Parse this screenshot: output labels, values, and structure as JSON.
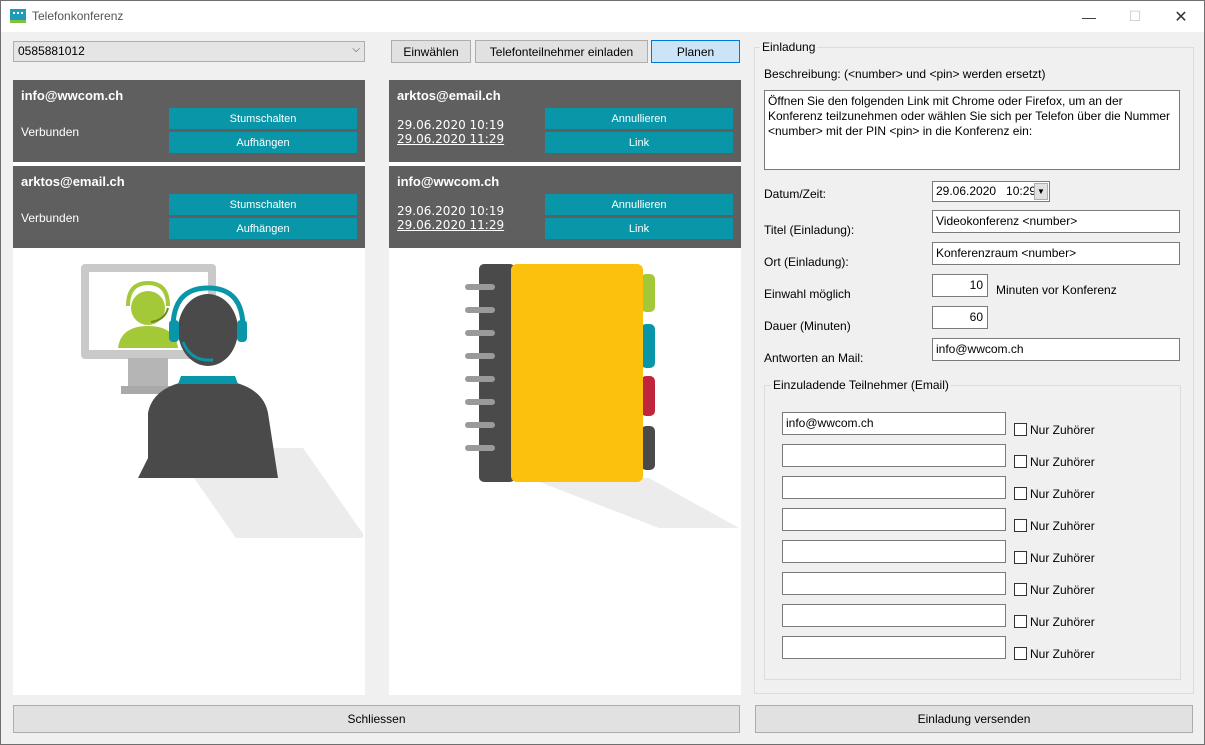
{
  "window": {
    "title": "Telefonkonferenz",
    "min": "—",
    "max": "☐",
    "close": "✕"
  },
  "phone": {
    "value": "0585881012"
  },
  "actions": {
    "dial": "Einwählen",
    "invite_phone": "Telefonteilnehmer einladen",
    "plan": "Planen"
  },
  "left_cards": [
    {
      "email": "info@wwcom.ch",
      "status": "Verbunden",
      "mute": "Stumschalten",
      "hangup": "Aufhängen"
    },
    {
      "email": "arktos@email.ch",
      "status": "Verbunden",
      "mute": "Stumschalten",
      "hangup": "Aufhängen"
    }
  ],
  "mid_cards": [
    {
      "email": "arktos@email.ch",
      "start": "29.06.2020 10:19",
      "end": "29.06.2020 11:29",
      "cancel": "Annullieren",
      "link": "Link"
    },
    {
      "email": "info@wwcom.ch",
      "start": "29.06.2020 10:19",
      "end": "29.06.2020 11:29",
      "cancel": "Annullieren",
      "link": "Link"
    }
  ],
  "invite": {
    "group_label": "Einladung",
    "desc_label": "Beschreibung: (<number> und <pin> werden ersetzt)",
    "desc_text": "Öffnen Sie den folgenden Link mit Chrome oder Firefox, um an der Konferenz teilzunehmen oder wählen Sie sich per Telefon über die Nummer <number> mit der PIN <pin> in die Konferenz ein:",
    "datetime_label": "Datum/Zeit:",
    "datetime_value": "29.06.2020   10:29",
    "title_label": "Titel (Einladung):",
    "title_value": "Videokonferenz <number>",
    "location_label": "Ort (Einladung):",
    "location_value": "Konferenzraum <number>",
    "dialin_label": "Einwahl möglich",
    "dialin_value": "10",
    "dialin_suffix": "Minuten vor Konferenz",
    "duration_label": "Dauer (Minuten)",
    "duration_value": "60",
    "reply_label": "Antworten an Mail:",
    "reply_value": "info@wwcom.ch",
    "participants_label": "Einzuladende Teilnehmer (Email)",
    "participants": [
      {
        "email": "info@wwcom.ch",
        "listen": "Nur Zuhörer"
      },
      {
        "email": "",
        "listen": "Nur Zuhörer"
      },
      {
        "email": "",
        "listen": "Nur Zuhörer"
      },
      {
        "email": "",
        "listen": "Nur Zuhörer"
      },
      {
        "email": "",
        "listen": "Nur Zuhörer"
      },
      {
        "email": "",
        "listen": "Nur Zuhörer"
      },
      {
        "email": "",
        "listen": "Nur Zuhörer"
      },
      {
        "email": "",
        "listen": "Nur Zuhörer"
      }
    ]
  },
  "footer": {
    "close": "Schliessen",
    "send": "Einladung versenden"
  },
  "colors": {
    "card_bg": "#5f5f5f",
    "teal": "#0996a9",
    "green": "#a3c939",
    "yellow": "#fcc10c",
    "red": "#c0253b",
    "dark": "#4a4a4a"
  },
  "icons": [
    "window-icon",
    "headset-person-icon",
    "address-book-icon",
    "dropdown-arrow-icon"
  ]
}
